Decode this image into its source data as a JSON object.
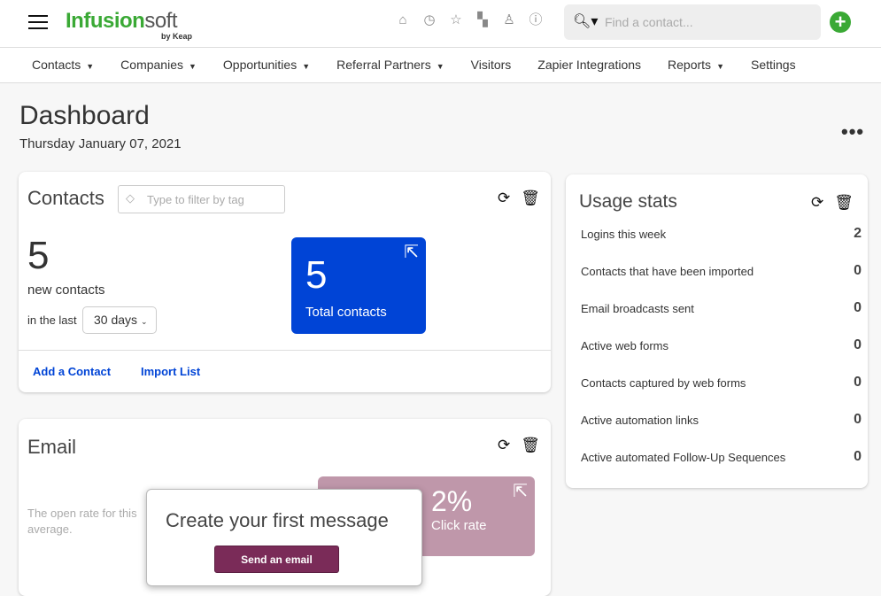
{
  "header": {
    "logo": "Infusion",
    "logo_suffix": "soft",
    "logo_byline": "by Keap",
    "search_placeholder": "Find a contact...",
    "icons": [
      "home-icon",
      "clock-icon",
      "star-icon",
      "quick-launch-icon",
      "user-icon",
      "help-icon"
    ]
  },
  "nav": [
    {
      "label": "Contacts",
      "dropdown": true
    },
    {
      "label": "Companies",
      "dropdown": true
    },
    {
      "label": "Opportunities",
      "dropdown": true
    },
    {
      "label": "Referral Partners",
      "dropdown": true
    },
    {
      "label": "Visitors",
      "dropdown": false
    },
    {
      "label": "Zapier Integrations",
      "dropdown": false
    },
    {
      "label": "Reports",
      "dropdown": true
    },
    {
      "label": "Settings",
      "dropdown": false
    }
  ],
  "page": {
    "title": "Dashboard",
    "date": "Thursday January 07, 2021",
    "more": "•••"
  },
  "contacts": {
    "title": "Contacts",
    "tag_placeholder": "Type to filter by tag",
    "new_count": "5",
    "new_label": "new contacts",
    "in_last": "in the last",
    "period": "30 days",
    "total": "5",
    "total_label": "Total contacts",
    "add": "Add a Contact",
    "import": "Import List"
  },
  "usage": {
    "title": "Usage stats",
    "rows": [
      {
        "label": "Logins this week",
        "value": "2"
      },
      {
        "label": "Contacts that have been imported",
        "value": "0"
      },
      {
        "label": "Email broadcasts sent",
        "value": "0"
      },
      {
        "label": "Active web forms",
        "value": "0"
      },
      {
        "label": "Contacts captured by web forms",
        "value": "0"
      },
      {
        "label": "Active automation links",
        "value": "0"
      },
      {
        "label": "Active automated Follow-Up Sequences",
        "value": "0"
      }
    ]
  },
  "email": {
    "title": "Email",
    "open_rate_text": "The open rate for this average.",
    "click_value": "2%",
    "click_label": "Click rate",
    "popup_title": "Create your first message",
    "popup_button": "Send an email"
  },
  "colors": {
    "brand_green": "#3aa935",
    "primary_blue": "#0044d6",
    "click_rate_bg": "#bf97aa",
    "send_button": "#7a2b58"
  }
}
